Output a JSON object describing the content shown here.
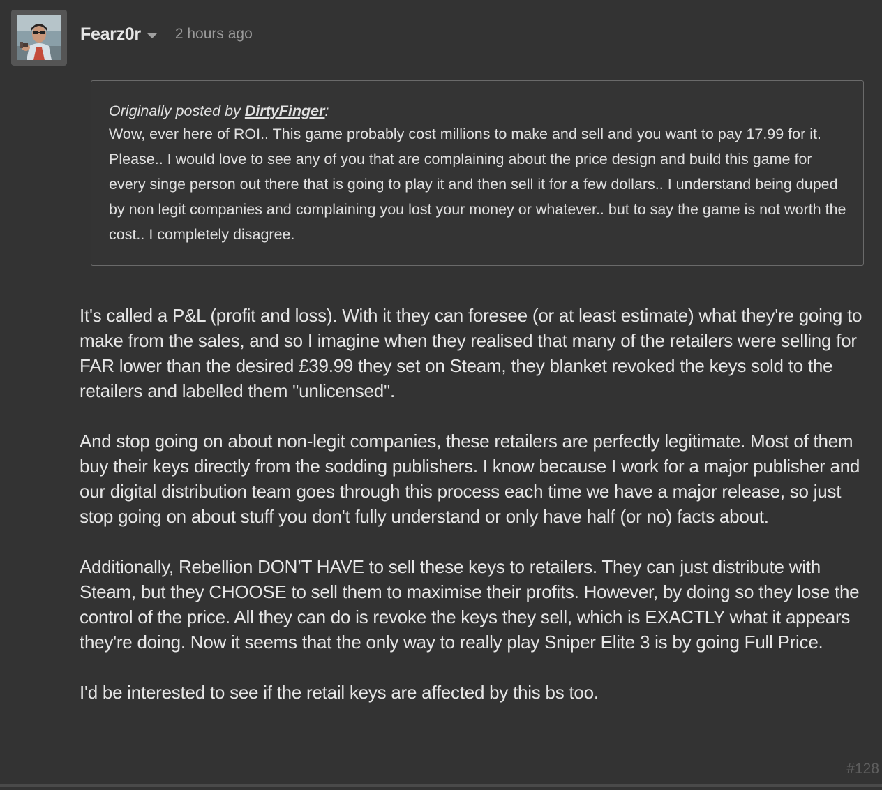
{
  "post": {
    "author": "Fearz0r",
    "timestamp": "2 hours ago",
    "post_number": "#128",
    "quote": {
      "prefix": "Originally posted by ",
      "author": "DirtyFinger",
      "suffix": ":",
      "text": "Wow, ever here of ROI.. This game probably cost millions to make and sell and you want to pay 17.99 for it. Please.. I would love to see any of you that are complaining about the price design and build this game for every singe person out there that is going to play it and then sell it for a few dollars.. I understand being duped by non legit companies and complaining you lost your money or whatever.. but to say the game is not worth the cost.. I completely disagree."
    },
    "paragraphs": [
      "It's called a P&L (profit and loss). With it they can foresee (or at least estimate) what they're going to make from the sales, and so I imagine when they realised that many of the retailers were selling for FAR lower than the desired £39.99 they set on Steam, they blanket revoked the keys sold to the retailers and labelled them \"unlicensed\".",
      "And stop going on about non-legit companies, these retailers are perfectly legitimate. Most of them buy their keys directly from the sodding publishers. I know because I work for a major publisher and our digital distribution team goes through this process each time we have a major release, so just stop going on about stuff you don't fully understand or only have half (or no) facts about.",
      "Additionally, Rebellion DON’T HAVE to sell these keys to retailers. They can just distribute with Steam, but they CHOOSE to sell them to maximise their profits. However, by doing so they lose the control of the price. All they can do is revoke the keys they sell, which is EXACTLY what it appears they're doing. Now it seems that the only way to really play Sniper Elite 3 is by going Full Price.",
      "I'd be interested to see if the retail keys are affected by this bs too."
    ]
  },
  "colors": {
    "background": "#333333",
    "text": "#e6e6e6",
    "muted": "#9a9a9a",
    "quote_border": "#6a6a6a",
    "post_number": "#5e5e5e"
  },
  "icons": {
    "author_menu": "chevron-down-icon"
  }
}
